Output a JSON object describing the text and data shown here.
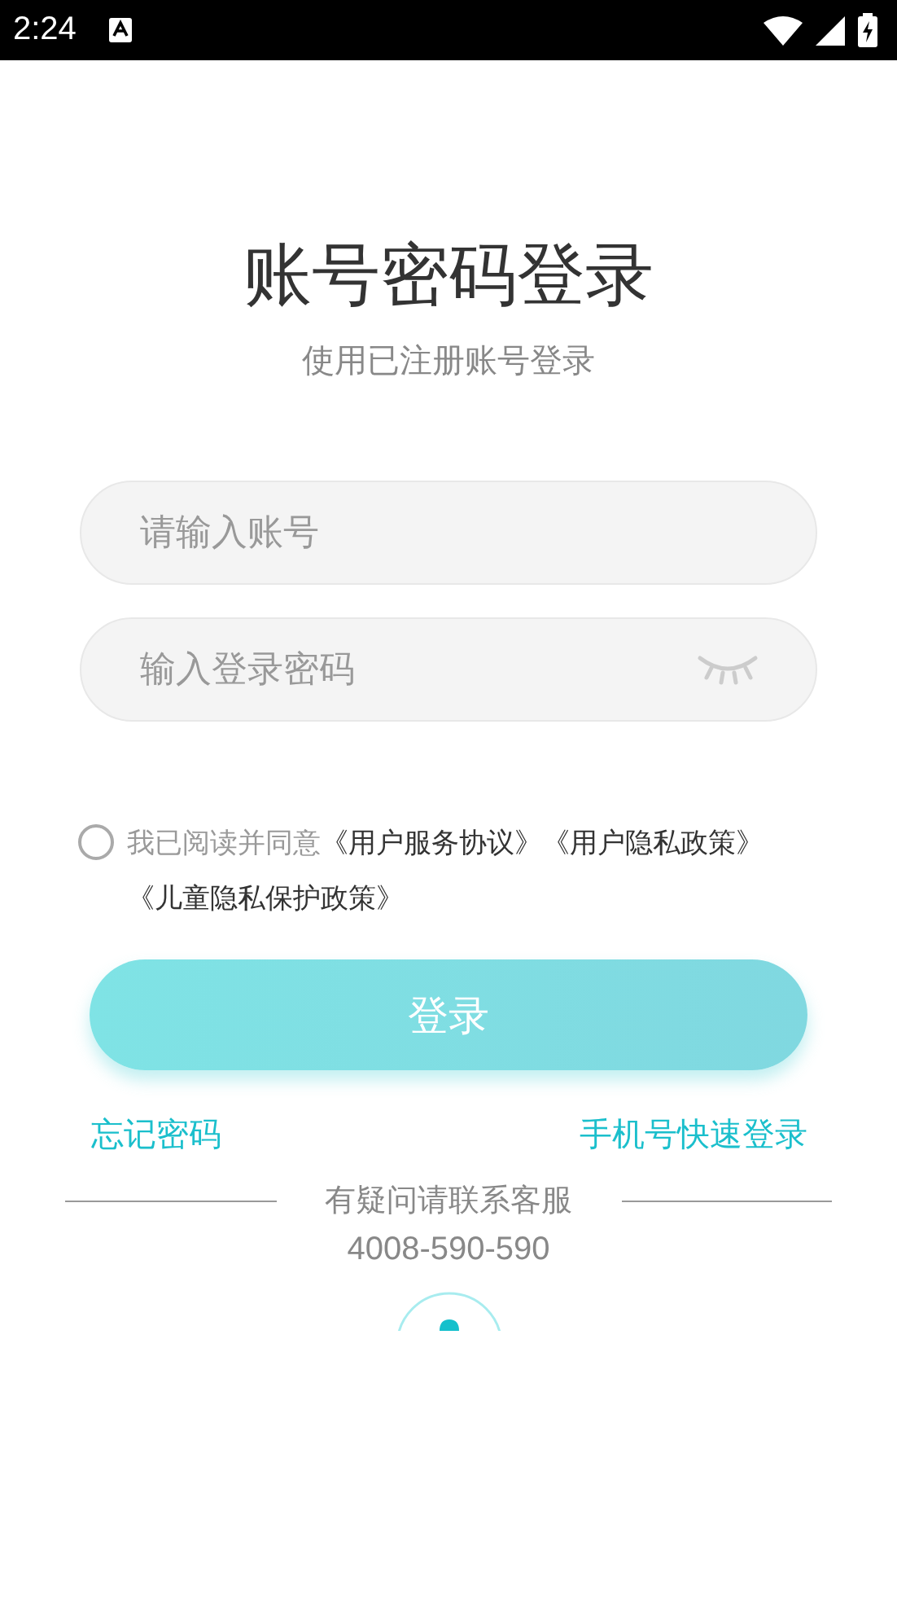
{
  "status_bar": {
    "time": "2:24"
  },
  "title": "账号密码登录",
  "subtitle": "使用已注册账号登录",
  "account_field": {
    "placeholder": "请输入账号"
  },
  "password_field": {
    "placeholder": "输入登录密码"
  },
  "agreement": {
    "checked": false,
    "prefix": "我已阅读并同意",
    "links": [
      "《用户服务协议》",
      "《用户隐私政策》",
      "《儿童隐私保护政策》"
    ]
  },
  "login_button": "登录",
  "forgot_password": "忘记密码",
  "phone_login": "手机号快速登录",
  "help": {
    "label": "有疑问请联系客服",
    "phone": "4008-590-590"
  }
}
